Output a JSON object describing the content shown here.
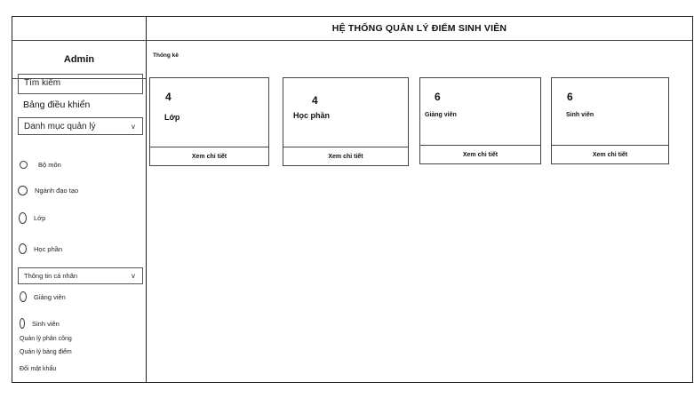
{
  "header": {
    "title": "HỆ THỐNG QUẢN LÝ ĐIỂM SINH VIÊN"
  },
  "sidebar": {
    "user": "Admin",
    "search_label": "Tìm kiếm",
    "dashboard_label": "Bảng điều khiển",
    "catalog_dropdown": {
      "label": "Danh mục quản lý",
      "arrow": "v"
    },
    "catalog_items": [
      "Bộ môn",
      "Ngành đạo tạo",
      "Lớp",
      "Học phần"
    ],
    "personal_dropdown": {
      "label": "Thông tin cá nhân",
      "arrow": "v"
    },
    "personal_items": [
      "Giảng viên",
      "Sinh viên"
    ],
    "links": [
      "Quản lý phân công",
      "Quản lý bảng điểm",
      "Đổi mật khẩu"
    ]
  },
  "main": {
    "section_label": "Thống kê",
    "cards": [
      {
        "value": "4",
        "label": "Lớp",
        "action": "Xem chi tiết"
      },
      {
        "value": "4",
        "label": "Học phần",
        "action": "Xem chi tiết"
      },
      {
        "value": "6",
        "label": "Giảng viên",
        "action": "Xem chi tiết"
      },
      {
        "value": "6",
        "label": "Sinh viên",
        "action": "Xem chi tiết"
      }
    ]
  }
}
